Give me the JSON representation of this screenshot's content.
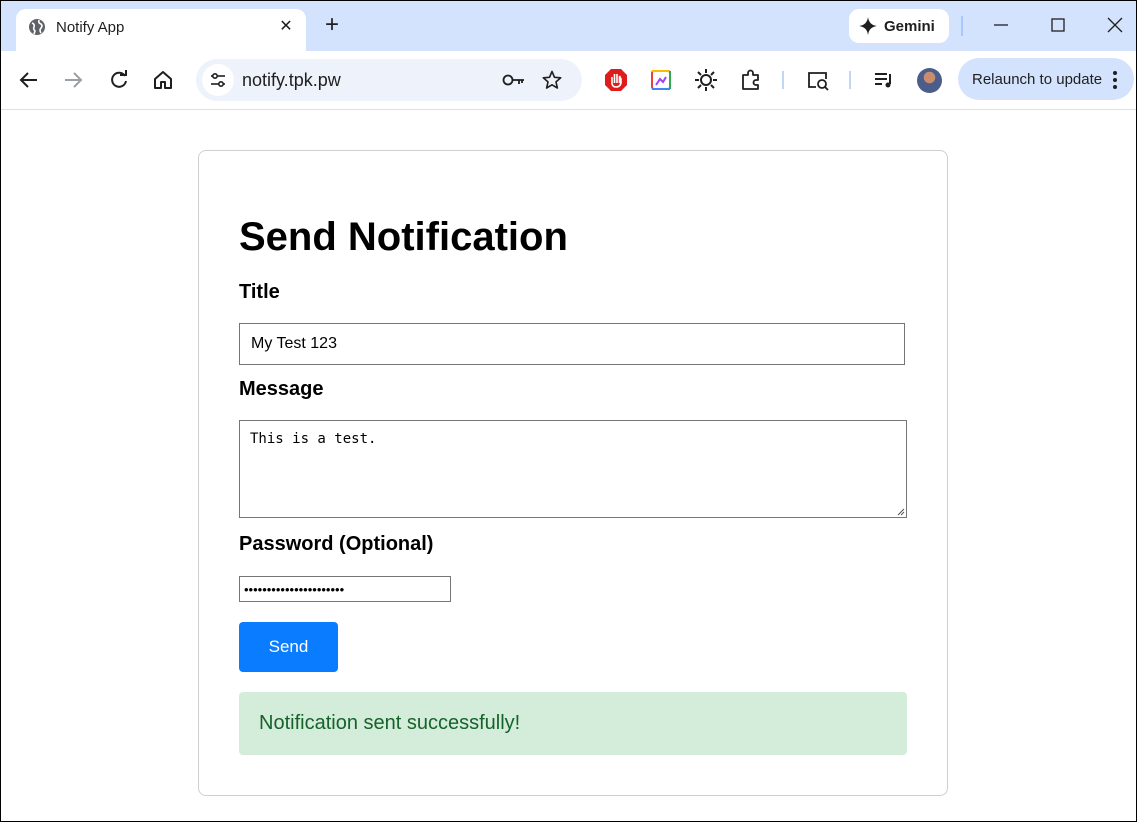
{
  "browser": {
    "tab_title": "Notify App",
    "tab_close_glyph": "✕",
    "new_tab_glyph": "+",
    "gemini_label": "Gemini",
    "url": "notify.tpk.pw",
    "relaunch_label": "Relaunch to update",
    "accent": "#d3e3fd"
  },
  "form": {
    "heading": "Send Notification",
    "title_label": "Title",
    "title_value": "My Test 123",
    "message_label": "Message",
    "message_value": "This is a test.",
    "password_label": "Password (Optional)",
    "password_value": "xxxxxxxxxxxxxxxxxxxxxx",
    "send_label": "Send",
    "button_color": "#0a7cff"
  },
  "alert": {
    "text": "Notification sent successfully!",
    "color": "#d4eddb"
  }
}
